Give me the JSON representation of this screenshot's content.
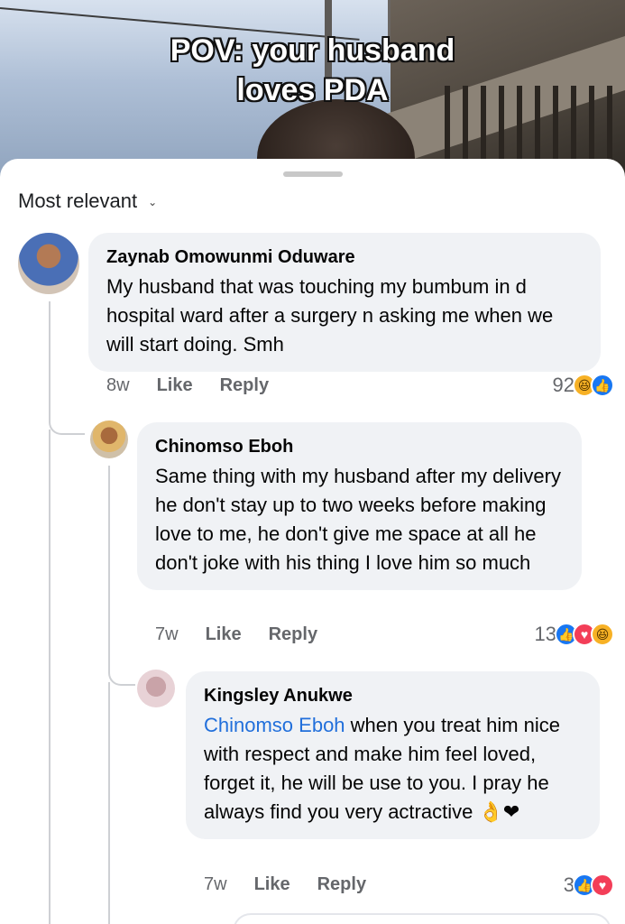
{
  "video": {
    "caption_line1": "POV: your husband",
    "caption_line2": "loves PDA"
  },
  "sort": {
    "label": "Most relevant",
    "icon": "chevron-down-icon"
  },
  "comments": [
    {
      "author": "Zaynab Omowunmi Oduware",
      "text": "My husband that was touching my bumbum in d hospital ward after a surgery n asking me when we will start doing. Smh",
      "time": "8w",
      "like_label": "Like",
      "reply_label": "Reply",
      "reaction_count": "92",
      "reactions": [
        "haha",
        "like"
      ]
    },
    {
      "author": "Chinomso Eboh",
      "text": "Same thing with my husband after my delivery he don't stay up to two weeks before making love to me, he don't give me space at all he don't joke with his thing I love him so much",
      "time": "7w",
      "like_label": "Like",
      "reply_label": "Reply",
      "reaction_count": "13",
      "reactions": [
        "like",
        "love",
        "haha"
      ]
    },
    {
      "author": "Kingsley Anukwe",
      "mention": "Chinomso Eboh",
      "text": " when you treat him nice with respect and make him feel loved, forget it, he will be use to you. I pray he always find you very actractive",
      "emoji": "👌❤",
      "time": "7w",
      "like_label": "Like",
      "reply_label": "Reply",
      "reaction_count": "3",
      "reactions": [
        "like",
        "love"
      ]
    }
  ],
  "colors": {
    "bubble": "#f0f2f5",
    "mention": "#216fdb",
    "like": "#1877f2",
    "love": "#f33e58",
    "haha": "#f7b125",
    "meta": "#65676b"
  }
}
